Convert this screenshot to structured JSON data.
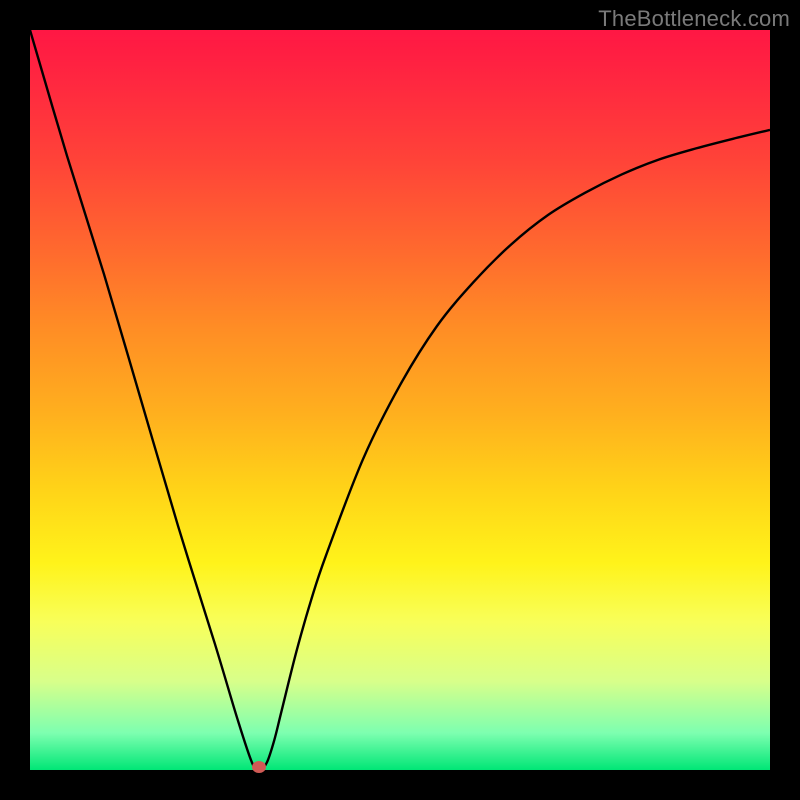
{
  "watermark": "TheBottleneck.com",
  "colors": {
    "curve_stroke": "#000000",
    "marker_fill": "#d05a55",
    "frame": "#000000"
  },
  "chart_data": {
    "type": "line",
    "title": "",
    "xlabel": "",
    "ylabel": "",
    "xlim": [
      0,
      100
    ],
    "ylim": [
      0,
      100
    ],
    "grid": false,
    "legend": false,
    "series": [
      {
        "name": "bottleneck-curve",
        "x": [
          0,
          5,
          10,
          15,
          20,
          25,
          28,
          30,
          31,
          32,
          33,
          34,
          36,
          38,
          40,
          45,
          50,
          55,
          60,
          65,
          70,
          75,
          80,
          85,
          90,
          95,
          100
        ],
        "y": [
          100,
          83,
          67,
          50,
          33,
          17,
          7,
          1,
          0,
          1,
          4,
          8,
          16,
          23,
          29,
          42,
          52,
          60,
          66,
          71,
          75,
          78,
          80.5,
          82.5,
          84,
          85.3,
          86.5
        ]
      }
    ],
    "annotations": [
      {
        "name": "minimum-marker",
        "x": 31,
        "y": 0
      }
    ]
  }
}
